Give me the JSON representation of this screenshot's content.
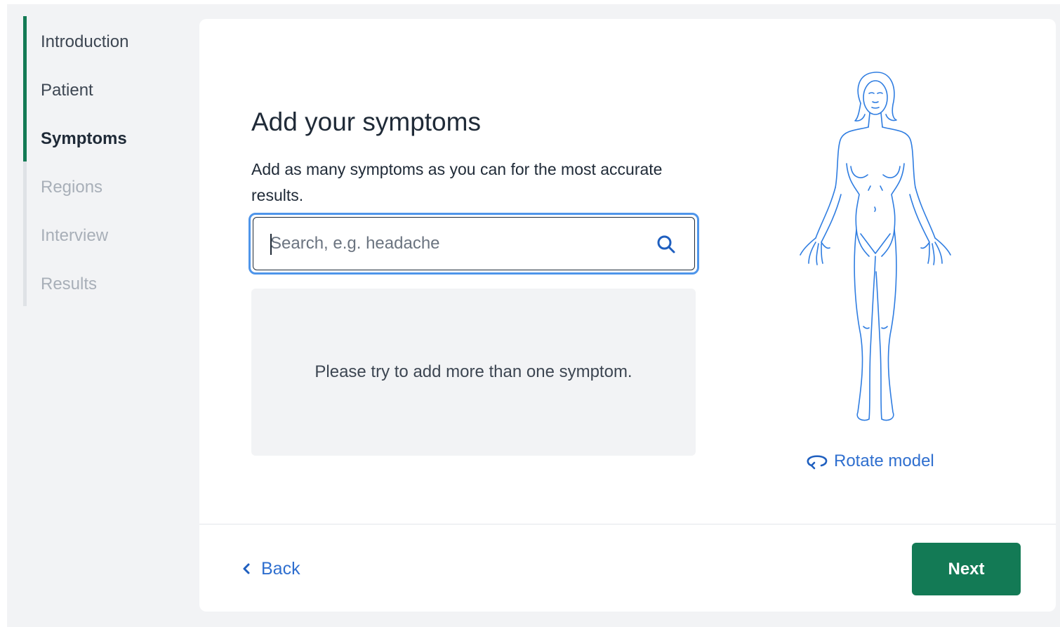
{
  "stepper": {
    "steps": [
      {
        "label": "Introduction",
        "state": "done"
      },
      {
        "label": "Patient",
        "state": "done"
      },
      {
        "label": "Symptoms",
        "state": "current"
      },
      {
        "label": "Regions",
        "state": "upcoming"
      },
      {
        "label": "Interview",
        "state": "upcoming"
      },
      {
        "label": "Results",
        "state": "upcoming"
      }
    ]
  },
  "main": {
    "title": "Add your symptoms",
    "subtitle": "Add as many symptoms as you can for the most accurate results.",
    "search": {
      "placeholder": "Search, e.g. headache",
      "value": "",
      "icon": "search-icon"
    },
    "empty_message": "Please try to add more than one symptom.",
    "rotate_label": "Rotate model",
    "rotate_icon": "rotate-icon"
  },
  "footer": {
    "back_label": "Back",
    "next_label": "Next"
  },
  "colors": {
    "accent_green": "#137a55",
    "link_blue": "#2f6fcf",
    "focus_ring": "#4e95ea",
    "model_stroke": "#2f7de1"
  }
}
